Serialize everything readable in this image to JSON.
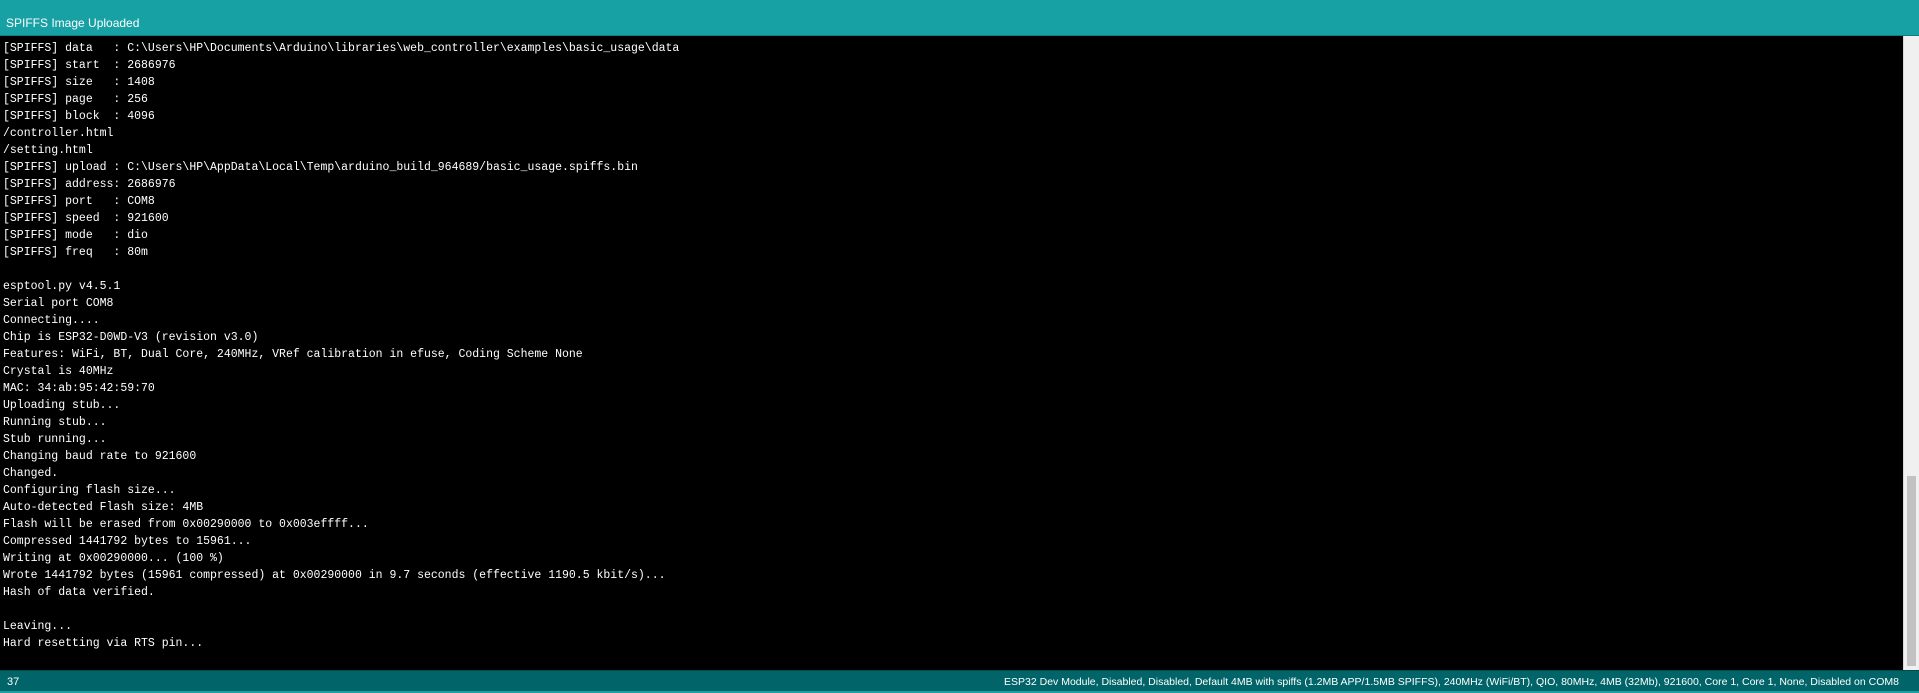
{
  "header": {
    "message": "SPIFFS Image Uploaded"
  },
  "console": {
    "lines": [
      "[SPIFFS] data   : C:\\Users\\HP\\Documents\\Arduino\\libraries\\web_controller\\examples\\basic_usage\\data",
      "[SPIFFS] start  : 2686976",
      "[SPIFFS] size   : 1408",
      "[SPIFFS] page   : 256",
      "[SPIFFS] block  : 4096",
      "/controller.html",
      "/setting.html",
      "[SPIFFS] upload : C:\\Users\\HP\\AppData\\Local\\Temp\\arduino_build_964689/basic_usage.spiffs.bin",
      "[SPIFFS] address: 2686976",
      "[SPIFFS] port   : COM8",
      "[SPIFFS] speed  : 921600",
      "[SPIFFS] mode   : dio",
      "[SPIFFS] freq   : 80m",
      "",
      "esptool.py v4.5.1",
      "Serial port COM8",
      "Connecting....",
      "Chip is ESP32-D0WD-V3 (revision v3.0)",
      "Features: WiFi, BT, Dual Core, 240MHz, VRef calibration in efuse, Coding Scheme None",
      "Crystal is 40MHz",
      "MAC: 34:ab:95:42:59:70",
      "Uploading stub...",
      "Running stub...",
      "Stub running...",
      "Changing baud rate to 921600",
      "Changed.",
      "Configuring flash size...",
      "Auto-detected Flash size: 4MB",
      "Flash will be erased from 0x00290000 to 0x003effff...",
      "Compressed 1441792 bytes to 15961...",
      "Writing at 0x00290000... (100 %)",
      "Wrote 1441792 bytes (15961 compressed) at 0x00290000 in 9.7 seconds (effective 1190.5 kbit/s)...",
      "Hash of data verified.",
      "",
      "Leaving...",
      "Hard resetting via RTS pin..."
    ]
  },
  "status_bar": {
    "line_number": "37",
    "board_info": "ESP32 Dev Module, Disabled, Disabled, Default 4MB with spiffs (1.2MB APP/1.5MB SPIFFS), 240MHz (WiFi/BT), QIO, 80MHz, 4MB (32Mb), 921600, Core 1, Core 1, None, Disabled on COM8"
  },
  "colors": {
    "header_bg": "#17a1a5",
    "console_bg": "#000000",
    "console_text": "#ffffff",
    "status_bar_bg": "#006468"
  }
}
